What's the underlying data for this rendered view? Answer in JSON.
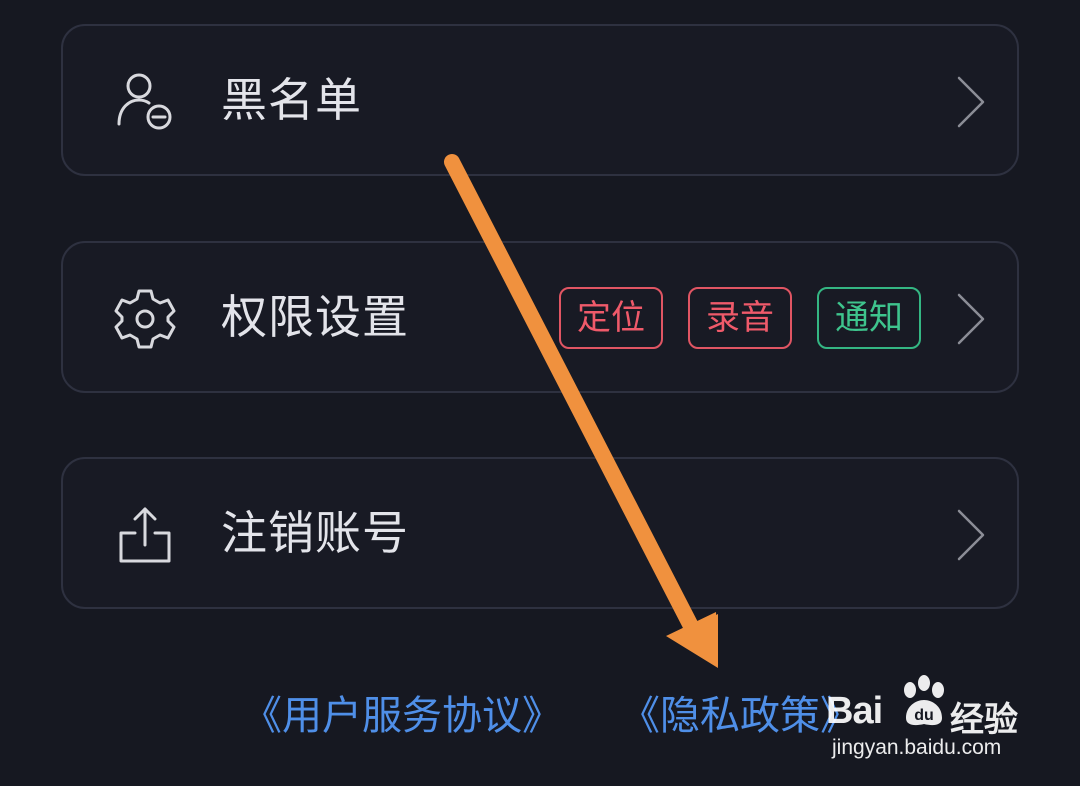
{
  "menu": {
    "blacklist": {
      "label": "黑名单",
      "icon": "user-minus-icon"
    },
    "permissions": {
      "label": "权限设置",
      "icon": "gear-icon",
      "tags": [
        {
          "text": "定位",
          "color": "#ef5a6a"
        },
        {
          "text": "录音",
          "color": "#ef5a6a"
        },
        {
          "text": "通知",
          "color": "#3ec48d"
        }
      ]
    },
    "delete_account": {
      "label": "注销账号",
      "icon": "export-icon"
    }
  },
  "footer": {
    "user_agreement": "《用户服务协议》",
    "privacy_policy": "《隐私政策》"
  },
  "watermark": {
    "brand": "Bai",
    "brand2": "经验",
    "url": "jingyan.baidu.com"
  },
  "colors": {
    "background": "#161821",
    "card_border": "#2e3140",
    "text": "#e3e4ea",
    "link": "#4f8fe8",
    "annotation_arrow": "#f0913e"
  }
}
